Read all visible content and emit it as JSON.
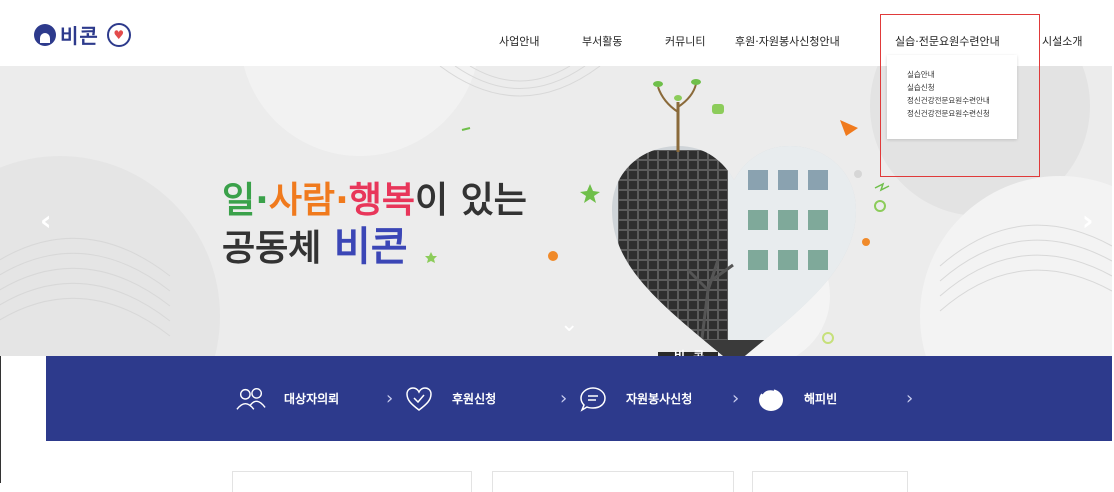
{
  "brand": {
    "name": "비콘",
    "tagline": "일·사람·행복이 있는 공동체"
  },
  "nav": {
    "items": [
      {
        "label": "사업안내"
      },
      {
        "label": "부서활동"
      },
      {
        "label": "커뮤니티"
      },
      {
        "label": "후원·자원봉사신청안내"
      },
      {
        "label": "실습·전문요원수련안내"
      },
      {
        "label": "시설소개"
      }
    ]
  },
  "dropdown": {
    "items": [
      {
        "label": "실습안내"
      },
      {
        "label": "실습신청"
      },
      {
        "label": "정신건강전문요원수련안내"
      },
      {
        "label": "정신건강전문요원수련신청"
      }
    ]
  },
  "hero": {
    "word_il": "일",
    "dot1": "·",
    "word_saram": "사람",
    "dot2": "·",
    "word_haengbok": "행복",
    "rest_line1": "이 있는",
    "line2_prefix": "공동체 ",
    "line2_brand": "비콘",
    "sign_text": "비 콘",
    "prev_arrow": "‹",
    "next_arrow": "›",
    "scroll_hint": "⌄"
  },
  "quick": {
    "items": [
      {
        "label": "대상자의뢰",
        "icon": "people-icon"
      },
      {
        "label": "후원신청",
        "icon": "heart-check-icon"
      },
      {
        "label": "자원봉사신청",
        "icon": "chat-icon"
      },
      {
        "label": "해피빈",
        "icon": "happybean-icon"
      }
    ],
    "separator": "›"
  },
  "colors": {
    "primary": "#2d3a8c",
    "highlight": "#e03a3a",
    "green": "#3aa14a",
    "orange": "#f07a1d",
    "red": "#e8365a"
  }
}
